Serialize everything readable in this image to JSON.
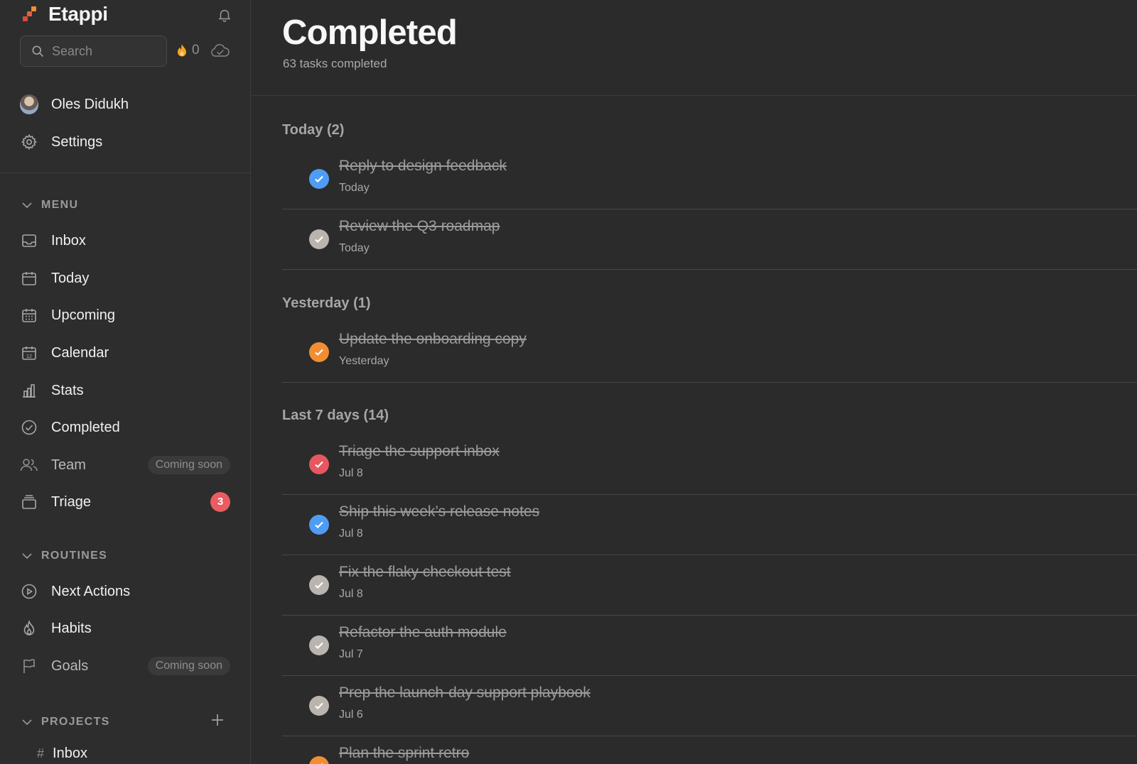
{
  "app": {
    "name": "Etappi"
  },
  "search": {
    "placeholder": "Search"
  },
  "streak": {
    "count": "0"
  },
  "user": {
    "name": "Oles Didukh"
  },
  "account": {
    "settings_label": "Settings"
  },
  "menu": {
    "heading": "MENU",
    "items": [
      {
        "label": "Inbox",
        "icon": "inbox-icon"
      },
      {
        "label": "Today",
        "icon": "calendar-icon"
      },
      {
        "label": "Upcoming",
        "icon": "calendar-grid-icon"
      },
      {
        "label": "Calendar",
        "icon": "calendar-12-icon"
      },
      {
        "label": "Stats",
        "icon": "bar-chart-icon"
      },
      {
        "label": "Completed",
        "icon": "check-circle-icon"
      },
      {
        "label": "Team",
        "icon": "people-icon",
        "pill": "Coming soon"
      },
      {
        "label": "Triage",
        "icon": "stack-icon",
        "badge": "3"
      }
    ]
  },
  "routines": {
    "heading": "ROUTINES",
    "items": [
      {
        "label": "Next Actions",
        "icon": "play-circle-icon"
      },
      {
        "label": "Habits",
        "icon": "flame-icon"
      },
      {
        "label": "Goals",
        "icon": "flag-icon",
        "pill": "Coming soon"
      }
    ]
  },
  "projects": {
    "heading": "PROJECTS",
    "items": [
      {
        "label": "Inbox",
        "prefix": "#"
      }
    ]
  },
  "page": {
    "title": "Completed",
    "subtitle": "63 tasks completed"
  },
  "groups": [
    {
      "title": "Today (2)",
      "tasks": [
        {
          "title": "Reply to design feedback",
          "date": "Today",
          "color": "#4f9cf5"
        },
        {
          "title": "Review the Q3 roadmap",
          "date": "Today",
          "color": "#b9b4ad"
        }
      ]
    },
    {
      "title": "Yesterday (1)",
      "tasks": [
        {
          "title": "Update the onboarding copy",
          "date": "Yesterday",
          "color": "#f28e32"
        }
      ]
    },
    {
      "title": "Last 7 days (14)",
      "tasks": [
        {
          "title": "Triage the support inbox",
          "date": "Jul 8",
          "color": "#e75760"
        },
        {
          "title": "Ship this week’s release notes",
          "date": "Jul 8",
          "color": "#4f9cf5"
        },
        {
          "title": "Fix the flaky checkout test",
          "date": "Jul 8",
          "color": "#b9b4ad"
        },
        {
          "title": "Refactor the auth module",
          "date": "Jul 7",
          "color": "#b9b4ad"
        },
        {
          "title": "Prep the launch-day support playbook",
          "date": "Jul 6",
          "color": "#b9b4ad"
        },
        {
          "title": "Plan the sprint retro",
          "date": "",
          "color": "#f28e32"
        }
      ]
    }
  ],
  "colors": {
    "accent": "#f28e32",
    "badge": "#ea5b62",
    "blue": "#4f9cf5",
    "gray": "#b9b4ad",
    "red": "#e75760"
  }
}
